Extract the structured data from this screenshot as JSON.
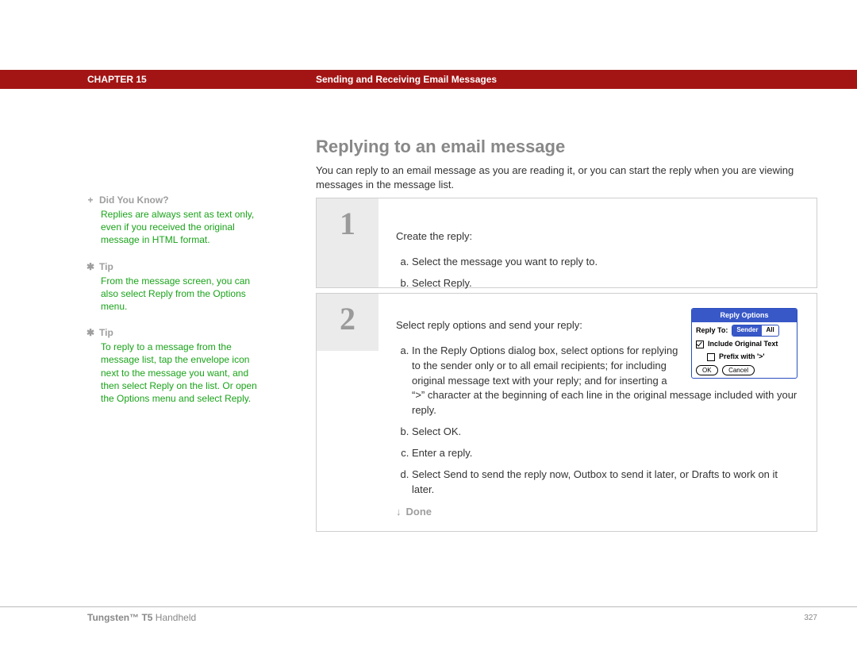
{
  "header": {
    "chapter": "CHAPTER 15",
    "section": "Sending and Receiving Email Messages"
  },
  "main": {
    "heading": "Replying to an email message",
    "intro": "You can reply to an email message as you are reading it, or you can start the reply when you are viewing messages in the message list."
  },
  "sidebar": {
    "items": [
      {
        "icon": "+",
        "title": "Did You Know?",
        "body": "Replies are always sent as text only, even if you received the original message in HTML format."
      },
      {
        "icon": "✱",
        "title": "Tip",
        "body": "From the message screen, you can also select Reply from the Options menu."
      },
      {
        "icon": "✱",
        "title": "Tip",
        "body": "To reply to a message from the message list, tap the envelope icon next to the message you want, and then select Reply on the list. Or open the Options menu and select Reply."
      }
    ]
  },
  "steps": {
    "step1": {
      "num": "1",
      "lead": "Create the reply:",
      "a": "Select the message you want to reply to.",
      "b": "Select Reply."
    },
    "step2": {
      "num": "2",
      "lead": "Select reply options and send your reply:",
      "a": "In the Reply Options dialog box, select options for replying to the sender only or to all email recipients; for including original message text with your reply; and for inserting a “>” character at the beginning of each line in the original message included with your reply.",
      "b": "Select OK.",
      "c": "Enter a reply.",
      "d": "Select Send to send the reply now, Outbox to send it later, or Drafts to work on it later."
    },
    "done": "Done"
  },
  "dialog": {
    "title": "Reply Options",
    "reply_to_label": "Reply To:",
    "sender": "Sender",
    "all": "All",
    "include_original": "Include Original Text",
    "prefix": "Prefix with '>'",
    "ok": "OK",
    "cancel": "Cancel"
  },
  "footer": {
    "product_bold": "Tungsten™ T5",
    "product_rest": " Handheld",
    "page": "327"
  }
}
